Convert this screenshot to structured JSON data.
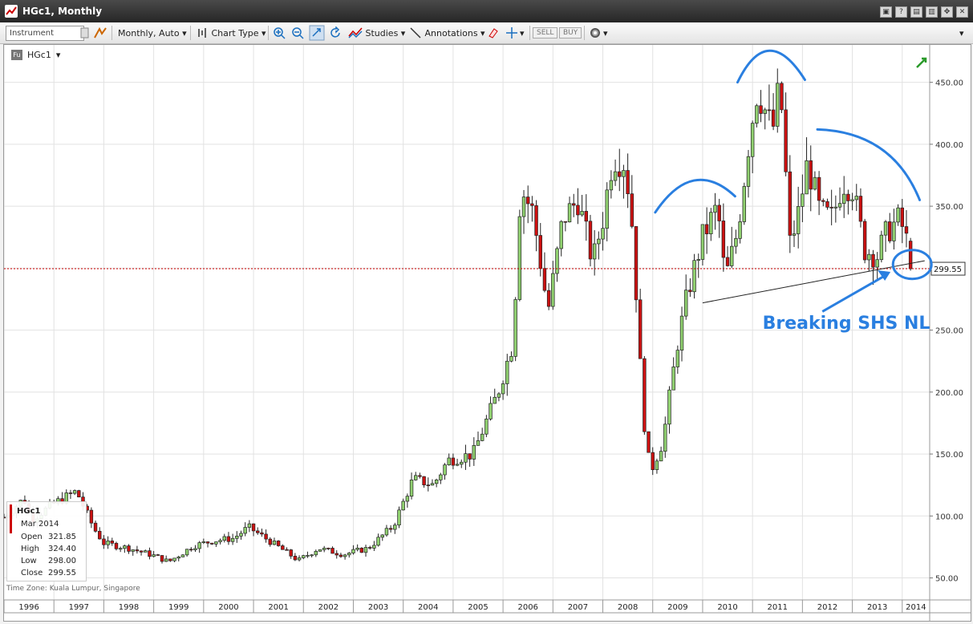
{
  "window": {
    "title": "HGc1, Monthly",
    "controls": [
      "▣",
      "?",
      "▤",
      "▥",
      "✥",
      "✕"
    ]
  },
  "toolbar": {
    "instrument_placeholder": "Instrument",
    "interval": "Monthly,",
    "auto": "Auto",
    "chart_type": "Chart Type",
    "studies": "Studies",
    "annotations": "Annotations",
    "sell": "SELL",
    "buy": "BUY"
  },
  "chart_header": {
    "badge": "Fu",
    "symbol": "HGc1"
  },
  "databox": {
    "symbol": "HGc1",
    "period": "Mar 2014",
    "rows": [
      {
        "label": "Open",
        "value": "321.85"
      },
      {
        "label": "High",
        "value": "324.40"
      },
      {
        "label": "Low",
        "value": "298.00"
      },
      {
        "label": "Close",
        "value": "299.55"
      }
    ]
  },
  "timezone": "Time Zone: Kuala Lumpur, Singapore",
  "annotation_text": "Breaking SHS NL",
  "colors": {
    "up": "#90d070",
    "down": "#cc1111",
    "annotation": "#2a7fe0",
    "price_line": "#cc0000"
  },
  "chart_data": {
    "type": "candlestick",
    "title": "HGc1, Monthly",
    "y_ticks": [
      "50.00",
      "100.00",
      "150.00",
      "200.00",
      "250.00",
      "300.00",
      "350.00",
      "400.00",
      "450.00"
    ],
    "ylim": [
      40,
      475
    ],
    "x_ticks": [
      "1996",
      "1997",
      "1998",
      "1999",
      "2000",
      "2001",
      "2002",
      "2003",
      "2004",
      "2005",
      "2006",
      "2007",
      "2008",
      "2009",
      "2010",
      "2011",
      "2012",
      "2013",
      "2014"
    ],
    "xlim": [
      1996.0,
      2014.55
    ],
    "last_price": 299.55,
    "last_price_label": "299.55",
    "grid": true,
    "neckline": {
      "x": [
        2010.0,
        2014.45
      ],
      "y": [
        272,
        306
      ]
    },
    "annotations": [
      {
        "text": "Breaking SHS NL",
        "type": "callout"
      }
    ],
    "anchors": [
      {
        "t": 1996.0,
        "c": 99
      },
      {
        "t": 1996.4,
        "c": 114
      },
      {
        "t": 1996.55,
        "c": 97
      },
      {
        "t": 1997.0,
        "c": 110
      },
      {
        "t": 1997.45,
        "c": 120
      },
      {
        "t": 1997.8,
        "c": 90
      },
      {
        "t": 1998.0,
        "c": 78
      },
      {
        "t": 1998.5,
        "c": 74
      },
      {
        "t": 1999.0,
        "c": 68
      },
      {
        "t": 1999.3,
        "c": 63
      },
      {
        "t": 1999.8,
        "c": 76
      },
      {
        "t": 2000.2,
        "c": 80
      },
      {
        "t": 2000.6,
        "c": 82
      },
      {
        "t": 2000.9,
        "c": 91
      },
      {
        "t": 2001.5,
        "c": 75
      },
      {
        "t": 2001.9,
        "c": 64
      },
      {
        "t": 2002.3,
        "c": 74
      },
      {
        "t": 2002.8,
        "c": 69
      },
      {
        "t": 2003.3,
        "c": 74
      },
      {
        "t": 2003.8,
        "c": 92
      },
      {
        "t": 2004.2,
        "c": 130
      },
      {
        "t": 2004.6,
        "c": 125
      },
      {
        "t": 2004.9,
        "c": 145
      },
      {
        "t": 2005.4,
        "c": 150
      },
      {
        "t": 2005.9,
        "c": 200
      },
      {
        "t": 2006.2,
        "c": 240
      },
      {
        "t": 2006.35,
        "c": 365
      },
      {
        "t": 2006.6,
        "c": 345
      },
      {
        "t": 2006.9,
        "c": 265
      },
      {
        "t": 2007.2,
        "c": 340
      },
      {
        "t": 2007.5,
        "c": 355
      },
      {
        "t": 2007.8,
        "c": 305
      },
      {
        "t": 2008.0,
        "c": 340
      },
      {
        "t": 2008.2,
        "c": 390
      },
      {
        "t": 2008.45,
        "c": 385
      },
      {
        "t": 2008.6,
        "c": 330
      },
      {
        "t": 2008.8,
        "c": 185
      },
      {
        "t": 2008.95,
        "c": 135
      },
      {
        "t": 2009.2,
        "c": 160
      },
      {
        "t": 2009.5,
        "c": 240
      },
      {
        "t": 2009.7,
        "c": 280
      },
      {
        "t": 2010.0,
        "c": 325
      },
      {
        "t": 2010.3,
        "c": 350
      },
      {
        "t": 2010.45,
        "c": 290
      },
      {
        "t": 2010.7,
        "c": 330
      },
      {
        "t": 2010.95,
        "c": 410
      },
      {
        "t": 2011.1,
        "c": 445
      },
      {
        "t": 2011.4,
        "c": 410
      },
      {
        "t": 2011.55,
        "c": 450
      },
      {
        "t": 2011.75,
        "c": 320
      },
      {
        "t": 2011.9,
        "c": 340
      },
      {
        "t": 2012.1,
        "c": 385
      },
      {
        "t": 2012.35,
        "c": 345
      },
      {
        "t": 2012.6,
        "c": 340
      },
      {
        "t": 2012.8,
        "c": 370
      },
      {
        "t": 2013.0,
        "c": 365
      },
      {
        "t": 2013.25,
        "c": 315
      },
      {
        "t": 2013.5,
        "c": 310
      },
      {
        "t": 2013.7,
        "c": 330
      },
      {
        "t": 2013.95,
        "c": 340
      },
      {
        "t": 2014.1,
        "c": 320
      },
      {
        "t": 2014.17,
        "c": 299.55
      }
    ]
  }
}
